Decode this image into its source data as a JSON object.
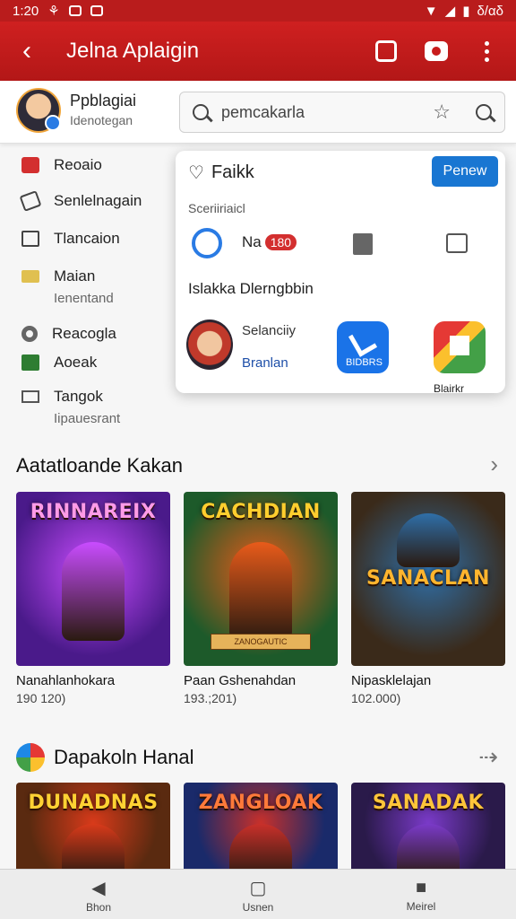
{
  "status": {
    "time": "1:20",
    "battery": "δ/αδ"
  },
  "appbar": {
    "title": "Jelna Aplaigin"
  },
  "profile": {
    "name": "Ppblagiai",
    "subtitle": "Idenotegan"
  },
  "search": {
    "value": "pemcakarla"
  },
  "sidebar": {
    "items": [
      {
        "label": "Reoaio",
        "icon": "bookmark-icon"
      },
      {
        "label": "Senlelnagain",
        "icon": "tag-icon"
      },
      {
        "label": "Tlancaion",
        "icon": "bag-icon"
      },
      {
        "label": "Maian",
        "icon": "ticket-icon"
      },
      {
        "label": "Reacogla",
        "icon": "circle-icon"
      },
      {
        "label": "Aoeak",
        "icon": "check-icon"
      },
      {
        "label": "Tangok",
        "icon": "list-icon"
      }
    ],
    "subs": [
      "Ienentand",
      "Iipauesrant"
    ]
  },
  "popup": {
    "title": "Faikk",
    "button": "Penew",
    "section": "Sceriiriaicl",
    "badge_prefix": "Na",
    "badge": "180",
    "caption": "Islakka Dlerngbbin",
    "user_line1": "Selanciiy",
    "user_line2": "Branlan",
    "tile_label": "BIDBRS",
    "tile_cut_label": "Blairkr"
  },
  "section1": {
    "title": "Aatatloande Kakan",
    "cards": [
      {
        "title": "RINNAREIX",
        "name": "Nanahlanhokara",
        "count": "190 120)",
        "bg": "#4a1a8a",
        "accent": "#c94cff",
        "title_color": "#ff9be8",
        "sub": ""
      },
      {
        "title": "CACHDIAN",
        "name": "Paan Gshenahdan",
        "count": "193.;201)",
        "bg": "#1d5a2a",
        "accent": "#e85b1a",
        "title_color": "#ffce2e",
        "sub": "ZANOGAUTIC"
      },
      {
        "title": "SANACLAN",
        "name": "Nipasklelajan",
        "count": "102.000)",
        "bg": "#3a2a1a",
        "accent": "#2f6fa8",
        "title_color": "#ffb52e",
        "sub": ""
      }
    ]
  },
  "section2": {
    "title": "Dapakoln Hanal",
    "cards": [
      {
        "title": "DUNADNAS",
        "bg": "#5a2a10",
        "accent": "#d83a1a",
        "title_color": "#ffd233"
      },
      {
        "title": "ZANGLOAK",
        "bg": "#1a2a6a",
        "accent": "#c8302a",
        "title_color": "#ff7a3a"
      },
      {
        "title": "SANADAK",
        "bg": "#2a1a4a",
        "accent": "#7a3ac8",
        "title_color": "#ffc53a"
      }
    ]
  },
  "navbar": {
    "back": "Bhon",
    "home": "Usnen",
    "recent": "Meirel"
  },
  "colors": {
    "primary": "#c81b1b",
    "accent": "#1976d2"
  }
}
